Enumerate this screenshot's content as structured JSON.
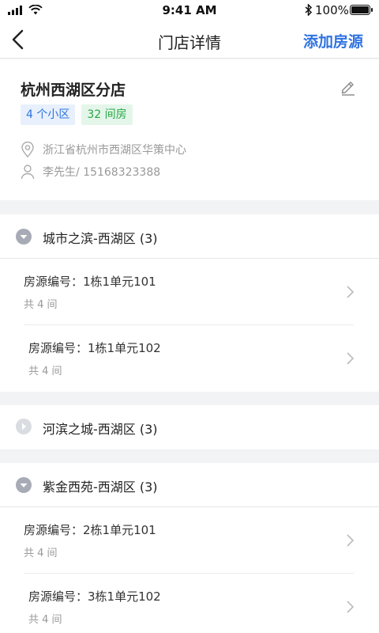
{
  "status_bar": {
    "time": "9:41 AM",
    "battery": "100%"
  },
  "nav": {
    "title": "门店详情",
    "action": "添加房源"
  },
  "store": {
    "name": "杭州西湖区分店",
    "tags": [
      "4 个小区",
      "32 间房"
    ],
    "address": "浙江省杭州市西湖区华策中心",
    "contact": "李先生/ 15168323388"
  },
  "colors": {
    "accent": "#2f73e0",
    "tag_green": "#28a745",
    "page_bg": "#f2f3f5"
  },
  "sections": [
    {
      "title": "城市之滨-西湖区 (3)",
      "expanded": true,
      "rooms": [
        {
          "code": "房源编号：1栋1单元101",
          "count": "共 4 间"
        },
        {
          "code": "房源编号：1栋1单元102",
          "count": "共 4 间"
        }
      ]
    },
    {
      "title": "河滨之城-西湖区 (3)",
      "expanded": false,
      "rooms": []
    },
    {
      "title": "紫金西苑-西湖区 (3)",
      "expanded": true,
      "rooms": [
        {
          "code": "房源编号：2栋1单元101",
          "count": "共 4 间"
        },
        {
          "code": "房源编号：3栋1单元102",
          "count": "共 4 间"
        }
      ]
    }
  ]
}
